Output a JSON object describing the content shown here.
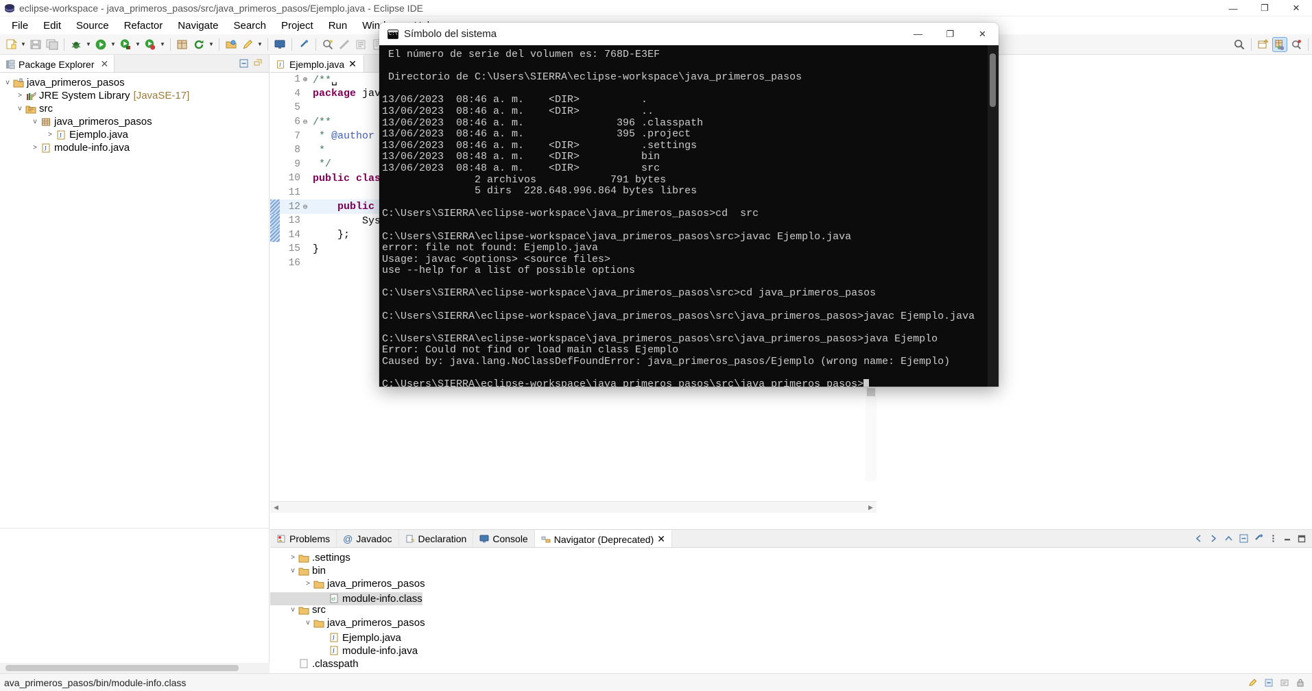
{
  "window": {
    "title": "eclipse-workspace - java_primeros_pasos/src/java_primeros_pasos/Ejemplo.java - Eclipse IDE",
    "minimize_label": "—",
    "maximize_label": "❐",
    "close_label": "✕"
  },
  "menu": {
    "items": [
      {
        "label": "File"
      },
      {
        "label": "Edit"
      },
      {
        "label": "Source"
      },
      {
        "label": "Refactor"
      },
      {
        "label": "Navigate"
      },
      {
        "label": "Search"
      },
      {
        "label": "Project"
      },
      {
        "label": "Run"
      },
      {
        "label": "Window"
      },
      {
        "label": "Help"
      }
    ]
  },
  "toolbar": {
    "icons": [
      "new-file-icon",
      "save-icon",
      "save-all-icon",
      "debug-icon",
      "run-icon",
      "coverage-icon",
      "profile-icon",
      "new-java-project-icon",
      "refresh-icon",
      "open-folder-icon",
      "pencil-icon",
      "terminal-icon",
      "link-icon",
      "search-all-icon",
      "ruler-icon",
      "outline-icon",
      "paragraph-icon",
      "next-annotation-icon",
      "previous-annotation-icon"
    ],
    "right_icons": [
      "search-icon",
      "new-window-icon",
      "java-perspective-icon",
      "debug-perspective-icon"
    ]
  },
  "package_explorer": {
    "tab_label": "Package Explorer",
    "tab_icon": "package-explorer-icon",
    "close_icon": "close-icon",
    "tools": [
      "collapse-all-icon",
      "link-with-editor-icon"
    ],
    "tree": [
      {
        "label": "java_primeros_pasos",
        "icon": "java-project-icon",
        "twisty": "v",
        "indent": 0,
        "suffix": ""
      },
      {
        "label": "JRE System Library",
        "icon": "library-icon",
        "twisty": ">",
        "indent": 1,
        "suffix": "[JavaSE-17]"
      },
      {
        "label": "src",
        "icon": "source-folder-icon",
        "twisty": "v",
        "indent": 1,
        "suffix": ""
      },
      {
        "label": "java_primeros_pasos",
        "icon": "package-icon",
        "twisty": "v",
        "indent": 2,
        "suffix": ""
      },
      {
        "label": "Ejemplo.java",
        "icon": "java-file-icon",
        "twisty": ">",
        "indent": 3,
        "suffix": ""
      },
      {
        "label": "module-info.java",
        "icon": "java-file-icon",
        "twisty": ">",
        "indent": 2,
        "suffix": ""
      }
    ]
  },
  "editor": {
    "tab_label": "Ejemplo.java",
    "tab_icon": "java-file-icon",
    "close_icon": "close-icon",
    "lines": [
      {
        "num": "1",
        "fold": "⊕",
        "html": "<span class=\"cm\">/**</span><span class=\"plain\">␣</span>",
        "highlight": false,
        "marker": false
      },
      {
        "num": "4",
        "fold": "",
        "html": "<span class=\"kw\">package</span> <span class=\"plain\">java_pri</span>",
        "highlight": false,
        "marker": false
      },
      {
        "num": "5",
        "fold": "",
        "html": "",
        "highlight": false,
        "marker": false
      },
      {
        "num": "6",
        "fold": "⊖",
        "html": "<span class=\"cm\">/**</span>",
        "highlight": false,
        "marker": false
      },
      {
        "num": "7",
        "fold": "",
        "html": "<span class=\"cm\"> * </span><span class=\"jd\">@author</span><span class=\"jd\"> SIER</span>",
        "highlight": false,
        "marker": false
      },
      {
        "num": "8",
        "fold": "",
        "html": "<span class=\"cm\"> *</span>",
        "highlight": false,
        "marker": false
      },
      {
        "num": "9",
        "fold": "",
        "html": "<span class=\"cm\"> */</span>",
        "highlight": false,
        "marker": false
      },
      {
        "num": "10",
        "fold": "",
        "html": "<span class=\"kw\">public class</span> <span class=\"plain\">Ej</span>",
        "highlight": false,
        "marker": false
      },
      {
        "num": "11",
        "fold": "",
        "html": "",
        "highlight": false,
        "marker": false
      },
      {
        "num": "12",
        "fold": "⊖",
        "html": "<span class=\"plain\">    </span><span class=\"kw\">public stati</span>",
        "highlight": true,
        "marker": true
      },
      {
        "num": "13",
        "fold": "",
        "html": "<span class=\"plain\">        System.</span>",
        "highlight": false,
        "marker": true
      },
      {
        "num": "14",
        "fold": "",
        "html": "<span class=\"plain\">    };</span>",
        "highlight": false,
        "marker": true
      },
      {
        "num": "15",
        "fold": "",
        "html": "<span class=\"plain\">}</span>",
        "highlight": false,
        "marker": false
      },
      {
        "num": "16",
        "fold": "",
        "html": "",
        "highlight": false,
        "marker": false
      }
    ]
  },
  "cmd": {
    "title": "Símbolo del sistema",
    "icon": "cmd-icon",
    "minimize_label": "—",
    "maximize_label": "❐",
    "close_label": "✕",
    "lines": [
      " El número de serie del volumen es: 768D-E3EF",
      "",
      " Directorio de C:\\Users\\SIERRA\\eclipse-workspace\\java_primeros_pasos",
      "",
      "13/06/2023  08:46 a. m.    <DIR>          .",
      "13/06/2023  08:46 a. m.    <DIR>          ..",
      "13/06/2023  08:46 a. m.               396 .classpath",
      "13/06/2023  08:46 a. m.               395 .project",
      "13/06/2023  08:46 a. m.    <DIR>          .settings",
      "13/06/2023  08:48 a. m.    <DIR>          bin",
      "13/06/2023  08:48 a. m.    <DIR>          src",
      "               2 archivos            791 bytes",
      "               5 dirs  228.648.996.864 bytes libres",
      "",
      "C:\\Users\\SIERRA\\eclipse-workspace\\java_primeros_pasos>cd  src",
      "",
      "C:\\Users\\SIERRA\\eclipse-workspace\\java_primeros_pasos\\src>javac Ejemplo.java",
      "error: file not found: Ejemplo.java",
      "Usage: javac <options> <source files>",
      "use --help for a list of possible options",
      "",
      "C:\\Users\\SIERRA\\eclipse-workspace\\java_primeros_pasos\\src>cd java_primeros_pasos",
      "",
      "C:\\Users\\SIERRA\\eclipse-workspace\\java_primeros_pasos\\src\\java_primeros_pasos>javac Ejemplo.java",
      "",
      "C:\\Users\\SIERRA\\eclipse-workspace\\java_primeros_pasos\\src\\java_primeros_pasos>java Ejemplo",
      "Error: Could not find or load main class Ejemplo",
      "Caused by: java.lang.NoClassDefFoundError: java_primeros_pasos/Ejemplo (wrong name: Ejemplo)",
      ""
    ],
    "prompt_line": "C:\\Users\\SIERRA\\eclipse-workspace\\java_primeros_pasos\\src\\java_primeros_pasos>"
  },
  "bottom_view": {
    "tabs": [
      {
        "label": "Problems",
        "icon": "problems-icon",
        "active": false
      },
      {
        "label": "Javadoc",
        "icon": "javadoc-icon",
        "active": false
      },
      {
        "label": "Declaration",
        "icon": "declaration-icon",
        "active": false
      },
      {
        "label": "Console",
        "icon": "console-icon",
        "active": false
      },
      {
        "label": "Navigator (Deprecated)",
        "icon": "navigator-icon",
        "active": true
      }
    ],
    "close_icon": "close-icon",
    "tools": [
      "back-icon",
      "forward-icon",
      "up-icon",
      "collapse-all-icon",
      "link-icon",
      "view-menu-icon",
      "minimize-icon",
      "maximize-icon"
    ],
    "tree": [
      {
        "label": ".settings",
        "icon": "folder-icon",
        "twisty": ">",
        "indent": 1,
        "selected": false
      },
      {
        "label": "bin",
        "icon": "folder-icon",
        "twisty": "v",
        "indent": 1,
        "selected": false
      },
      {
        "label": "java_primeros_pasos",
        "icon": "folder-icon",
        "twisty": ">",
        "indent": 2,
        "selected": false
      },
      {
        "label": "module-info.class",
        "icon": "class-file-icon",
        "twisty": "",
        "indent": 3,
        "selected": true
      },
      {
        "label": "src",
        "icon": "folder-icon",
        "twisty": "v",
        "indent": 1,
        "selected": false
      },
      {
        "label": "java_primeros_pasos",
        "icon": "folder-icon",
        "twisty": "v",
        "indent": 2,
        "selected": false
      },
      {
        "label": "Ejemplo.java",
        "icon": "java-file-icon",
        "twisty": "",
        "indent": 3,
        "selected": false
      },
      {
        "label": "module-info.java",
        "icon": "java-file-icon",
        "twisty": "",
        "indent": 3,
        "selected": false
      },
      {
        "label": ".classpath",
        "icon": "file-icon",
        "twisty": "",
        "indent": 1,
        "selected": false
      }
    ]
  },
  "statusbar": {
    "text": "ava_primeros_pasos/bin/module-info.class",
    "right_icons": [
      "writable-icon",
      "smart-insert-icon",
      "position-icon",
      "lock-icon"
    ]
  },
  "colors": {
    "accent": "#0c0c0c",
    "keyword": "#7f0055",
    "comment": "#3f7f5f",
    "javadoc_tag": "#3f5fbf",
    "selection": "#eaf2fb",
    "chrome": "#f6f6f6"
  }
}
